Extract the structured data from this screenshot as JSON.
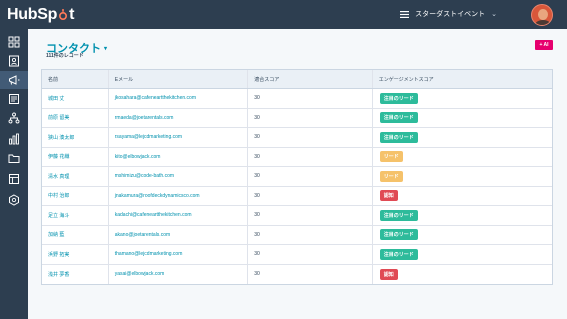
{
  "app": {
    "logo_text_left": "HubSp",
    "logo_text_right": "t",
    "nav_label": "スターダストイベント"
  },
  "colors": {
    "topbar": "#2d3e50",
    "accent": "#0091ae",
    "ai_button": "#e6006e",
    "badge_hot": "#2dbb9b",
    "badge_lead": "#f5c26b",
    "badge_cert": "#e04a55"
  },
  "sidebar": {
    "items": [
      {
        "icon": "grid-icon"
      },
      {
        "icon": "contacts-icon"
      },
      {
        "icon": "megaphone-icon"
      },
      {
        "icon": "inbox-icon"
      },
      {
        "icon": "workflow-icon"
      },
      {
        "icon": "reports-icon"
      },
      {
        "icon": "folder-icon"
      },
      {
        "icon": "library-icon"
      },
      {
        "icon": "settings-icon"
      }
    ]
  },
  "page": {
    "title": "コンタクト",
    "record_count": "111件のレコード",
    "ai_button": "+ AI"
  },
  "table": {
    "columns": [
      "名前",
      "Eメール",
      "適合スコア",
      "エンゲージメントスコア"
    ],
    "rows": [
      {
        "name": "城田 丈",
        "email": "jkosahara@cafeneartthekitchen.com",
        "score": "30",
        "engagement": "注目のリード",
        "level": "hot"
      },
      {
        "name": "前原 留美",
        "email": "rmaeda@joetarentals.com",
        "score": "30",
        "engagement": "注目のリード",
        "level": "hot"
      },
      {
        "name": "狭山 湊太郎",
        "email": "rsayama@lejcdmarketing.com",
        "score": "30",
        "engagement": "注目のリード",
        "level": "hot"
      },
      {
        "name": "伊藤 花織",
        "email": "kito@elbowjack.com",
        "score": "30",
        "engagement": "リード",
        "level": "lead"
      },
      {
        "name": "清水 真理",
        "email": "mshimizu@code-bath.com",
        "score": "30",
        "engagement": "リード",
        "level": "lead"
      },
      {
        "name": "中村 治郎",
        "email": "jnakamura@roofdeckdynamicsco.com",
        "score": "30",
        "engagement": "認知",
        "level": "cert"
      },
      {
        "name": "足立 海斗",
        "email": "kadachi@cafeneartthekitchen.com",
        "score": "30",
        "engagement": "注目のリード",
        "level": "hot"
      },
      {
        "name": "加納 藍",
        "email": "akano@joetarentals.com",
        "score": "30",
        "engagement": "注目のリード",
        "level": "hot"
      },
      {
        "name": "浜野 拓実",
        "email": "thamano@lejcdmarketing.com",
        "score": "30",
        "engagement": "注目のリード",
        "level": "hot"
      },
      {
        "name": "浅井 夢香",
        "email": "yasai@elbowjack.com",
        "score": "30",
        "engagement": "認知",
        "level": "cert"
      }
    ]
  }
}
